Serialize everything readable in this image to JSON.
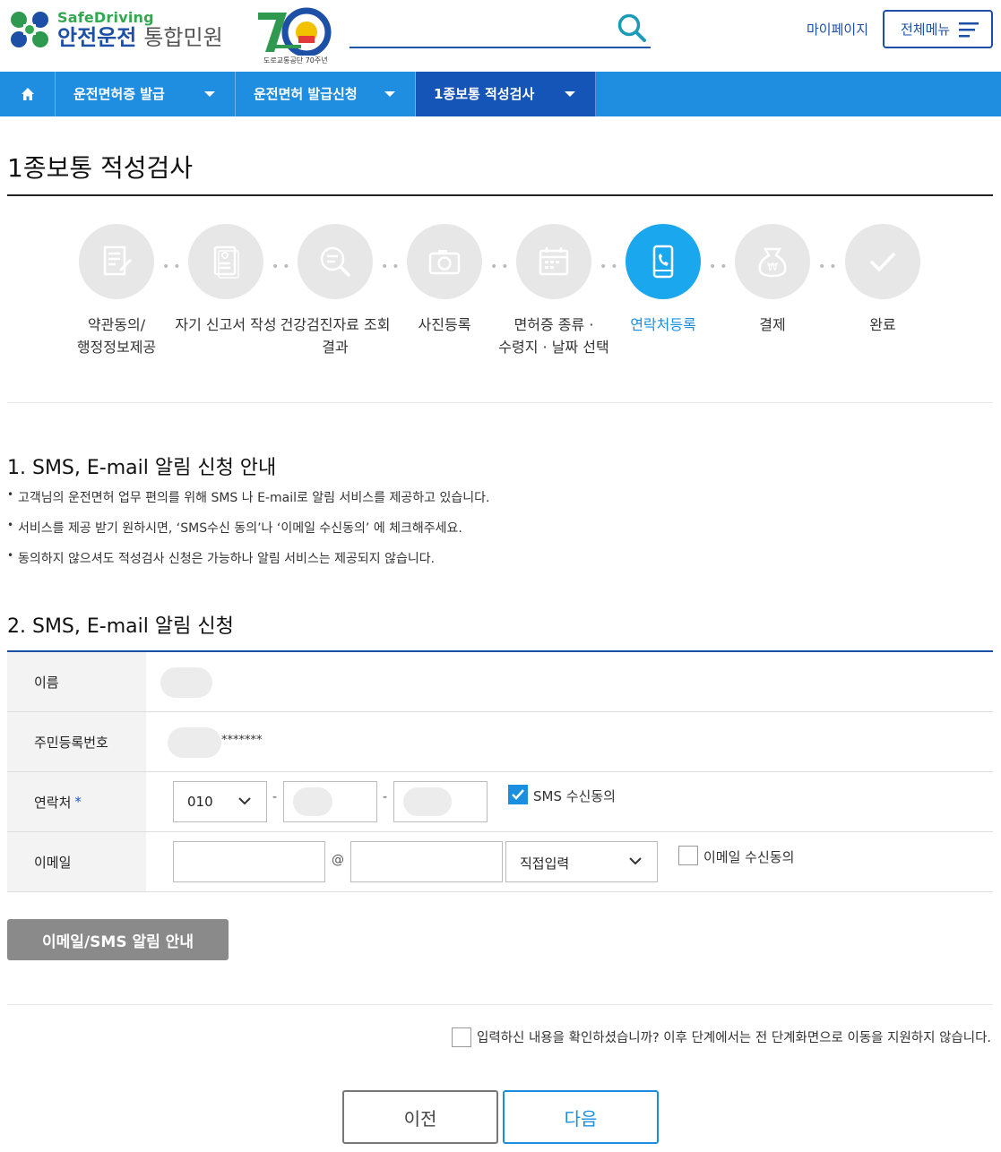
{
  "header": {
    "logo_top": "SafeDriving",
    "logo_main": "안전운전",
    "logo_sub": "통합민원",
    "anniv_text": "도로교통공단 70주년",
    "mypage": "마이페이지",
    "allmenu": "전체메뉴"
  },
  "nav": {
    "items": [
      {
        "label": "운전면허증 발급"
      },
      {
        "label": "운전면허 발급신청"
      },
      {
        "label": "1종보통 적성검사"
      }
    ]
  },
  "page": {
    "title": "1종보통 적성검사"
  },
  "steps": [
    {
      "line1": "약관동의/",
      "line2": "행정정보제공",
      "icon": "document-edit-icon",
      "active": false
    },
    {
      "line1": "자기 신고서 작성",
      "line2": "",
      "icon": "form-person-icon",
      "active": false
    },
    {
      "line1": "건강검진자료 조회",
      "line2": "결과",
      "icon": "search-doc-icon",
      "active": false
    },
    {
      "line1": "사진등록",
      "line2": "",
      "icon": "camera-icon",
      "active": false
    },
    {
      "line1": "면허증 종류 ·",
      "line2": "수령지 · 날짜 선택",
      "icon": "calendar-icon",
      "active": false
    },
    {
      "line1": "연락처등록",
      "line2": "",
      "icon": "phone-icon",
      "active": true
    },
    {
      "line1": "결제",
      "line2": "",
      "icon": "won-bag-icon",
      "active": false
    },
    {
      "line1": "완료",
      "line2": "",
      "icon": "check-icon",
      "active": false
    }
  ],
  "section1": {
    "title": "1. SMS, E-mail 알림 신청 안내",
    "bullets": [
      "고객님의 운전면허 업무 편의를 위해 SMS 나 E-mail로 알림 서비스를 제공하고 있습니다.",
      "서비스를 제공 받기 원하시면, ‘SMS수신 동의’나 ‘이메일 수신동의’ 에 체크해주세요.",
      "동의하지 않으셔도 적성검사 신청은 가능하나 알림 서비스는 제공되지 않습니다."
    ]
  },
  "section2": {
    "title": "2. SMS, E-mail 알림 신청"
  },
  "form": {
    "name_label": "이름",
    "rrn_label": "주민등록번호",
    "rrn_masked": "*******",
    "phone_label": "연락처",
    "phone_required": "*",
    "phone_prefix": "010",
    "phone_dash": "-",
    "sms_agree": "SMS 수신동의",
    "sms_checked": true,
    "email_label": "이메일",
    "email_at": "@",
    "email_domain_select": "직접입력",
    "email_agree": "이메일 수신동의",
    "email_checked": false
  },
  "buttons": {
    "notice": "이메일/SMS 알림 안내",
    "confirm_text": "입력하신 내용을 확인하셨습니까? 이후 단계에서는 전 단계화면으로 이동을 지원하지 않습니다.",
    "prev": "이전",
    "next": "다음"
  },
  "colors": {
    "brand_blue": "#1d4fa6",
    "nav_blue": "#1f8de0",
    "nav_active": "#1555b8",
    "active_step": "#1aa7ee",
    "logo_green": "#33a852"
  }
}
